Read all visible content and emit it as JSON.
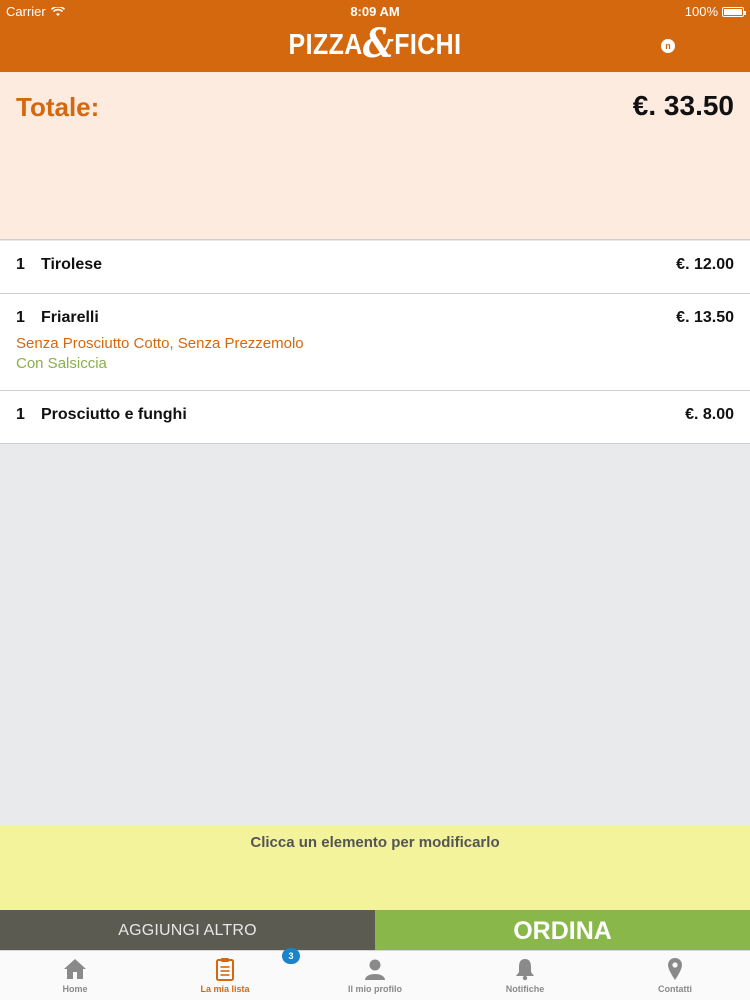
{
  "status_bar": {
    "carrier": "Carrier",
    "time": "8:09 AM",
    "battery": "100%"
  },
  "header": {
    "logo_left": "PIZZA",
    "logo_amp": "&",
    "logo_right": "FICHI",
    "icon_letter": "n"
  },
  "total": {
    "label": "Totale:",
    "value": "€. 33.50"
  },
  "items": [
    {
      "qty": "1",
      "name": "Tirolese",
      "price": "€. 12.00"
    },
    {
      "qty": "1",
      "name": "Friarelli",
      "price": "€. 13.50",
      "note_minus": "Senza Prosciutto Cotto, Senza Prezzemolo",
      "note_plus": "Con Salsiccia"
    },
    {
      "qty": "1",
      "name": "Prosciutto e funghi",
      "price": "€. 8.00"
    }
  ],
  "hint": "Clicca un elemento per modificarlo",
  "actions": {
    "add": "AGGIUNGI ALTRO",
    "order": "ORDINA"
  },
  "tabs": [
    {
      "label": "Home",
      "icon": "home-icon"
    },
    {
      "label": "La mia lista",
      "icon": "clipboard-icon",
      "active": true
    },
    {
      "label": "Il mio profilo",
      "icon": "user-icon"
    },
    {
      "label": "Notifiche",
      "icon": "bell-icon"
    },
    {
      "label": "Contatti",
      "icon": "map-pin-icon"
    }
  ],
  "badge_count": "3",
  "colors": {
    "brand_orange": "#d4680e",
    "order_green": "#8ab74a",
    "hint_yellow": "#f2f39a",
    "add_gray": "#5b5b52",
    "badge_blue": "#1a84c8"
  }
}
